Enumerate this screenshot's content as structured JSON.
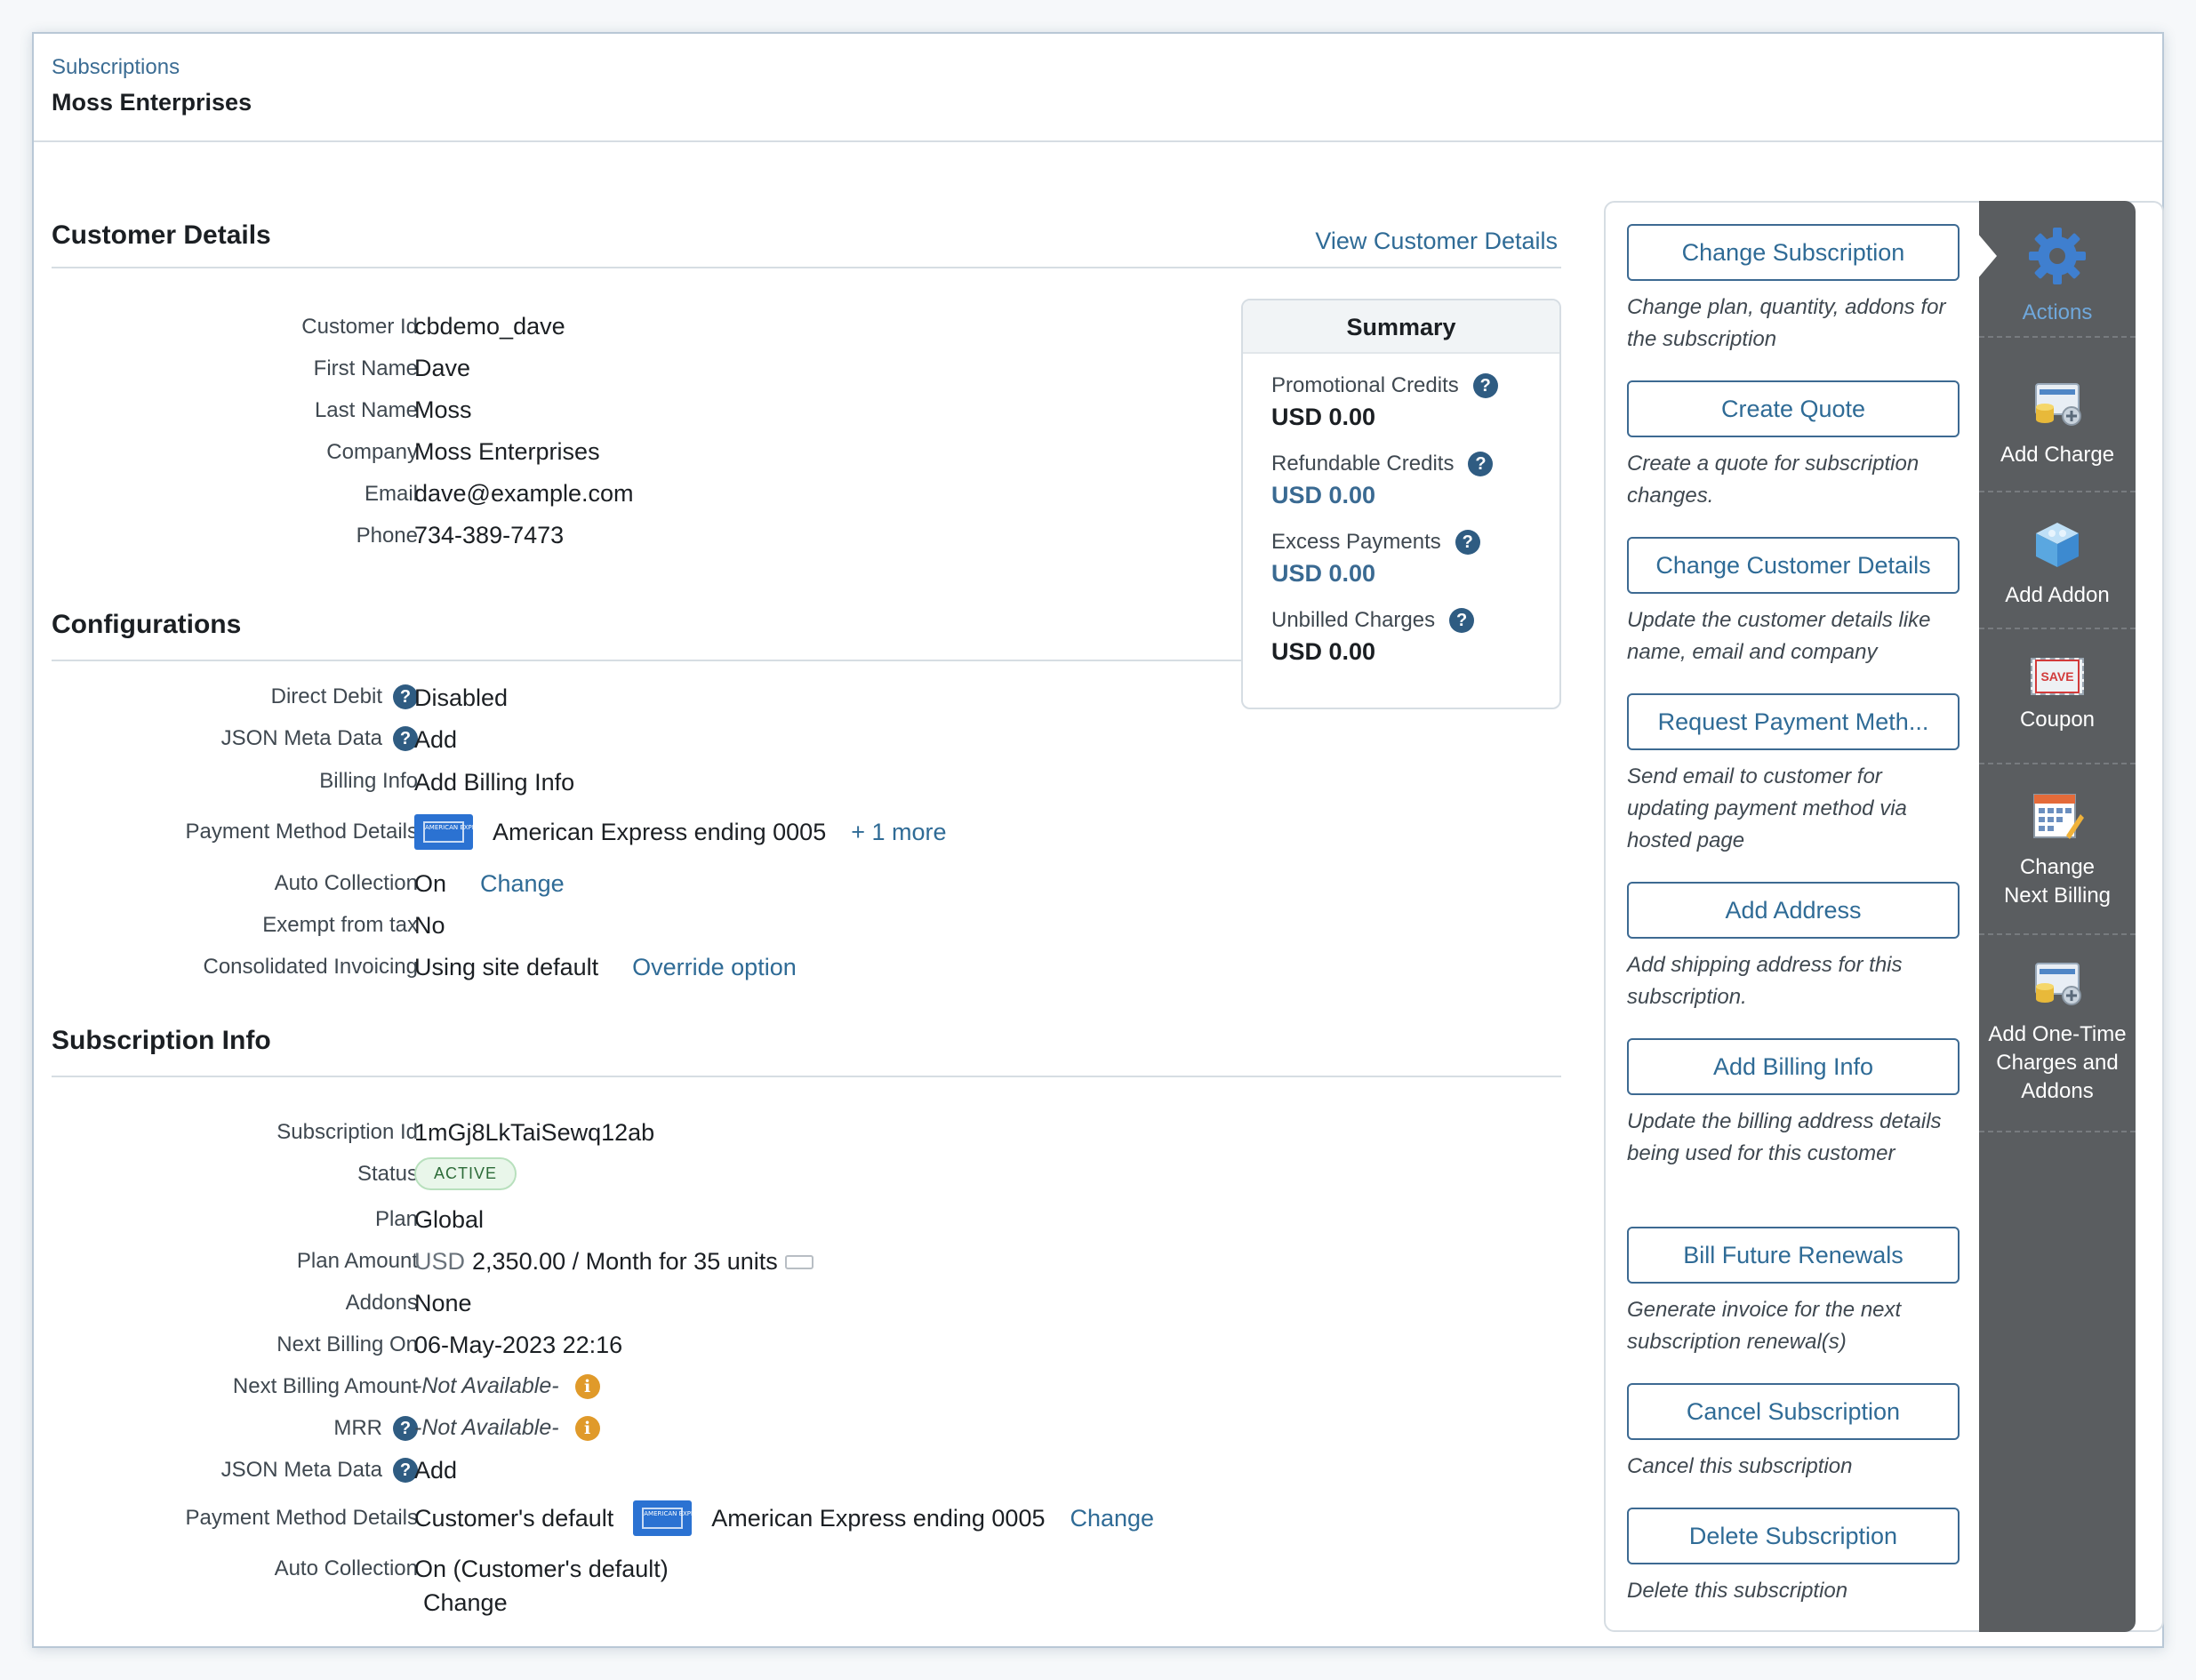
{
  "header": {
    "breadcrumb": "Subscriptions",
    "title": "Moss Enterprises"
  },
  "customer_details": {
    "title": "Customer Details",
    "view_link": "View Customer Details",
    "rows": [
      {
        "label": "Customer Id",
        "value": "cbdemo_dave"
      },
      {
        "label": "First Name",
        "value": "Dave"
      },
      {
        "label": "Last Name",
        "value": "Moss"
      },
      {
        "label": "Company",
        "value": "Moss Enterprises"
      },
      {
        "label": "Email",
        "value": "dave@example.com"
      },
      {
        "label": "Phone",
        "value": "734-389-7473"
      }
    ]
  },
  "summary": {
    "title": "Summary",
    "items": [
      {
        "label": "Promotional Credits",
        "amount": "USD 0.00",
        "amount_color": "#1b1f23"
      },
      {
        "label": "Refundable Credits",
        "amount": "USD 0.00",
        "amount_color": "#3a6a92"
      },
      {
        "label": "Excess Payments",
        "amount": "USD 0.00",
        "amount_color": "#3a6a92"
      },
      {
        "label": "Unbilled Charges",
        "amount": "USD 0.00",
        "amount_color": "#1b1f23"
      }
    ]
  },
  "configurations": {
    "title": "Configurations",
    "direct_debit": {
      "label": "Direct Debit",
      "value": "Disabled"
    },
    "json_meta": {
      "label": "JSON Meta Data",
      "value": "Add"
    },
    "billing_info": {
      "label": "Billing Info",
      "value": "Add Billing Info"
    },
    "payment_method": {
      "label": "Payment Method Details",
      "value": "American Express ending 0005",
      "more": "+ 1 more"
    },
    "auto_collection": {
      "label": "Auto Collection",
      "value": "On",
      "change": "Change"
    },
    "exempt_tax": {
      "label": "Exempt from tax",
      "value": "No"
    },
    "consolidated": {
      "label": "Consolidated Invoicing",
      "value": "Using site default",
      "override": "Override option"
    }
  },
  "subscription_info": {
    "title": "Subscription Info",
    "subscription_id": {
      "label": "Subscription Id",
      "value": "1mGj8LkTaiSewq12ab"
    },
    "status": {
      "label": "Status",
      "value": "ACTIVE"
    },
    "plan": {
      "label": "Plan",
      "value": "Global"
    },
    "plan_amount": {
      "label": "Plan Amount",
      "currency": "USD",
      "value": "2,350.00 / Month for 35 units"
    },
    "addons": {
      "label": "Addons",
      "value": "None"
    },
    "next_billing_on": {
      "label": "Next Billing On",
      "value": "06-May-2023 22:16"
    },
    "next_billing_amount": {
      "label": "Next Billing Amount",
      "value": "-Not Available-"
    },
    "mrr": {
      "label": "MRR",
      "value": "-Not Available-"
    },
    "json_meta": {
      "label": "JSON Meta Data",
      "value": "Add"
    },
    "payment_method": {
      "label": "Payment Method Details",
      "prefix": "Customer's default",
      "value": "American Express ending 0005",
      "change": "Change"
    },
    "auto_collection": {
      "label": "Auto Collection",
      "value": "On (Customer's default)",
      "change": "Change"
    }
  },
  "actions": [
    {
      "label": "Change Subscription",
      "desc": "Change plan, quantity, addons for the subscription"
    },
    {
      "label": "Create Quote",
      "desc": "Create a quote for subscription changes."
    },
    {
      "label": "Change Customer Details",
      "desc": "Update the customer details like name, email and company"
    },
    {
      "label": "Request Payment Meth...",
      "desc": "Send email to customer for updating payment method via hosted page"
    },
    {
      "label": "Add Address",
      "desc": "Add shipping address for this subscription."
    },
    {
      "label": "Add Billing Info",
      "desc": "Update the billing address details being used for this customer"
    },
    {
      "label": "Bill Future Renewals",
      "desc": "Generate invoice for the next subscription renewal(s)"
    },
    {
      "label": "Cancel Subscription",
      "desc": "Cancel this subscription"
    },
    {
      "label": "Delete Subscription",
      "desc": "Delete this subscription"
    }
  ],
  "sidebar": {
    "items": [
      {
        "label": "Actions",
        "icon": "gear-icon"
      },
      {
        "label": "Add Charge",
        "icon": "add-charge-icon"
      },
      {
        "label": "Add Addon",
        "icon": "addon-box-icon"
      },
      {
        "label": "Coupon",
        "icon": "coupon-icon",
        "icon_text": "SAVE"
      },
      {
        "label": "Change Next Billing",
        "icon": "calendar-icon"
      },
      {
        "label": "Add One-Time Charges and Addons",
        "icon": "one-time-charge-icon"
      }
    ]
  }
}
